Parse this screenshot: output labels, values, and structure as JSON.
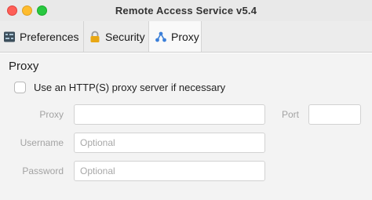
{
  "window": {
    "title": "Remote Access Service v5.4"
  },
  "tabs": [
    {
      "label": "Preferences",
      "icon": "preferences-icon"
    },
    {
      "label": "Security",
      "icon": "lock-icon"
    },
    {
      "label": "Proxy",
      "icon": "proxy-network-icon",
      "selected": true
    }
  ],
  "proxy_section": {
    "title": "Proxy",
    "use_proxy_label": "Use an HTTP(S) proxy server if necessary",
    "use_proxy_checked": false,
    "fields": {
      "proxy": {
        "label": "Proxy",
        "value": "",
        "placeholder": ""
      },
      "port": {
        "label": "Port",
        "value": "",
        "placeholder": ""
      },
      "username": {
        "label": "Username",
        "value": "",
        "placeholder": "Optional"
      },
      "password": {
        "label": "Password",
        "value": "",
        "placeholder": "Optional"
      }
    }
  },
  "colors": {
    "close": "#fe5f57",
    "minimize": "#febc2e",
    "maximize": "#28c840",
    "accent": "#3b7fd9",
    "lock": "#e8a714"
  }
}
